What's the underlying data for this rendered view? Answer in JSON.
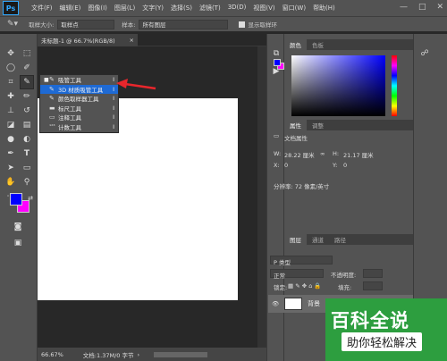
{
  "app": {
    "logo": "Ps",
    "menus": [
      "文件(F)",
      "编辑(E)",
      "图像(I)",
      "图层(L)",
      "文字(Y)",
      "选择(S)",
      "滤镜(T)",
      "3D(D)",
      "视图(V)",
      "窗口(W)",
      "帮助(H)"
    ],
    "win_controls": [
      "—",
      "□",
      "✕"
    ]
  },
  "options": {
    "sample_size_label": "取样大小:",
    "sample_size_value": "取样点",
    "sample_label": "样本:",
    "sample_value": "所有图层",
    "show_ring_label": "显示取样环"
  },
  "document": {
    "tab_title": "未标题-1 @ 66.7%(RGB/8)",
    "close": "×",
    "zoom": "66.67%",
    "doc_info": "文档:1.37M/0 字节"
  },
  "flyout": {
    "items": [
      {
        "label": "吸管工具",
        "key": "I",
        "icon": "✎",
        "bullet": "■"
      },
      {
        "label": "3D 材质吸管工具",
        "key": "I",
        "icon": "✎",
        "bullet": ""
      },
      {
        "label": "颜色取样器工具",
        "key": "I",
        "icon": "✎",
        "bullet": ""
      },
      {
        "label": "标尺工具",
        "key": "I",
        "icon": "▬",
        "bullet": ""
      },
      {
        "label": "注释工具",
        "key": "I",
        "icon": "▭",
        "bullet": ""
      },
      {
        "label": "计数工具",
        "key": "I",
        "icon": "¹²³",
        "bullet": ""
      }
    ]
  },
  "color_panel": {
    "tabs": [
      "颜色",
      "色板"
    ]
  },
  "properties": {
    "tabs": [
      "属性",
      "调整"
    ],
    "heading": "文档属性",
    "w_label": "W:",
    "w_value": "28.22 厘米",
    "h_label": "H:",
    "h_value": "21.17 厘米",
    "x_label": "X:",
    "x_value": "0",
    "y_label": "Y:",
    "y_value": "0",
    "resolution": "分辨率: 72 像素/英寸"
  },
  "layers": {
    "tabs": [
      "图层",
      "通道",
      "路径"
    ],
    "kind": "P 类型",
    "mode": "正常",
    "opacity": "不透明度:",
    "lock": "锁定:",
    "fill": "填充:",
    "layer_name": "背景"
  },
  "watermark": {
    "line1": "百科全说",
    "line2": "助你轻松解决"
  },
  "colors": {
    "foreground": "#0000ff",
    "background": "#ff00ff",
    "highlight": "#1e6ad4",
    "arrow": "#e8262c"
  }
}
